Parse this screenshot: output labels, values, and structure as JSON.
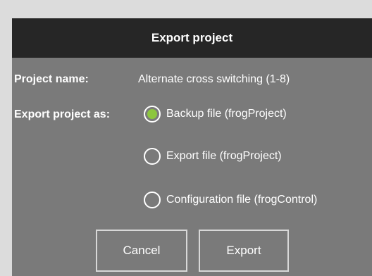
{
  "dialog": {
    "title": "Export project",
    "project_name_label": "Project name:",
    "project_name_value": "Alternate cross switching (1-8)",
    "export_as_label": "Export project as:",
    "options": [
      {
        "label": "Backup file (frogProject)",
        "selected": true
      },
      {
        "label": "Export file (frogProject)",
        "selected": false
      },
      {
        "label": "Configuration file (frogControl)",
        "selected": false
      }
    ],
    "cancel_label": "Cancel",
    "export_label": "Export"
  },
  "colors": {
    "header_bg": "#262626",
    "body_bg": "#7a7a7a",
    "accent": "#8dc63f",
    "text": "#ffffff"
  },
  "icons": {
    "radio_selected": "radio-selected-icon",
    "radio_unselected": "radio-unselected-icon"
  }
}
